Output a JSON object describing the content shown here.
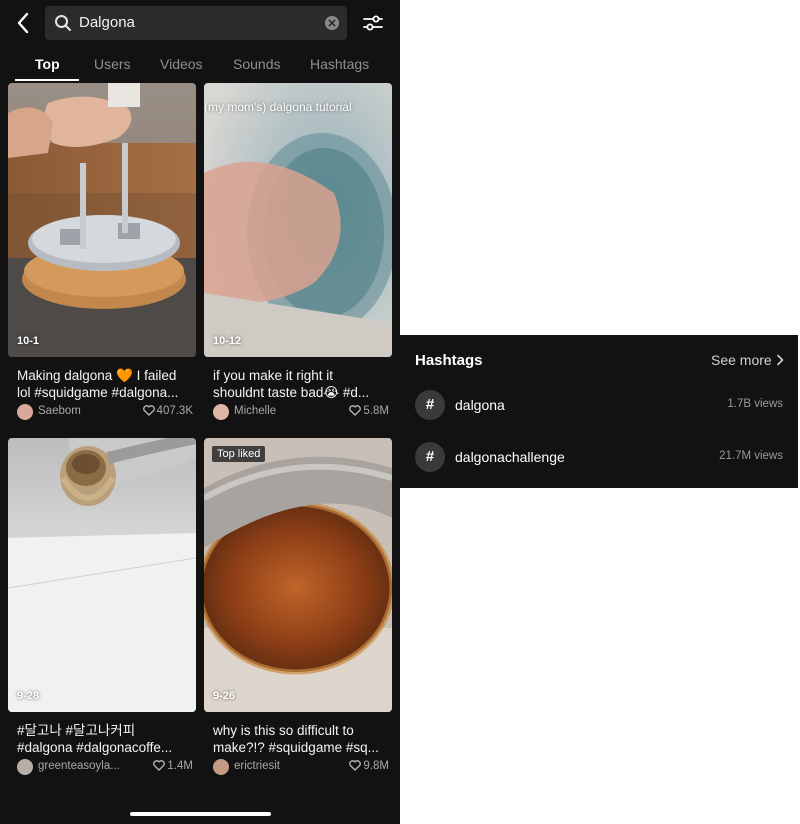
{
  "search": {
    "query": "Dalgona"
  },
  "tabs": [
    {
      "label": "Top",
      "active": true
    },
    {
      "label": "Users",
      "active": false
    },
    {
      "label": "Videos",
      "active": false
    },
    {
      "label": "Sounds",
      "active": false
    },
    {
      "label": "Hashtags",
      "active": false
    }
  ],
  "videos": [
    {
      "date": "10-1",
      "caption_line1": "Making dalgona 🧡 I failed",
      "caption_line2": "lol #squidgame #dalgona...",
      "username": "Saebom",
      "likes": "407.3K"
    },
    {
      "date": "10-12",
      "overlay_text": "(my mom's) dalgona tutorial",
      "caption_line1": "if you make it right it",
      "caption_line2": "shouldnt taste bad😭 #d...",
      "username": "Michelle",
      "likes": "5.8M"
    },
    {
      "date": "9-28",
      "caption_line1": "#달고나 #달고나커피",
      "caption_line2": "#dalgona #dalgonacoffe...",
      "username": "greenteasoyla...",
      "likes": "1.4M"
    },
    {
      "date": "9-26",
      "badge": "Top liked",
      "caption_line1": "why is this so difficult to",
      "caption_line2": "make?!? #squidgame #sq...",
      "username": "erictriesit",
      "likes": "9.8M"
    }
  ],
  "hashtags_panel": {
    "title": "Hashtags",
    "see_more": "See more",
    "items": [
      {
        "icon_text": "#",
        "name": "dalgona",
        "views": "1.7B views"
      },
      {
        "icon_text": "#",
        "name": "dalgonachallenge",
        "views": "21.7M views"
      }
    ]
  },
  "colors": {
    "background": "#121212",
    "search_bg": "#2b2b2b",
    "secondary_text": "#a8a8a8"
  },
  "icons": [
    "back-arrow-icon",
    "search-icon",
    "clear-icon",
    "filter-icon",
    "heart-icon",
    "hashtag-icon",
    "chevron-right-icon"
  ]
}
